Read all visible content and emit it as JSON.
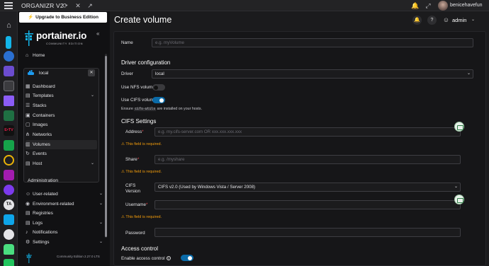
{
  "organizr": {
    "title": "ORGANIZR V2",
    "username": "benicehavefun"
  },
  "colors": {
    "accent": "#0b6ba8",
    "error": "#e5484d",
    "warning": "#f59e0b",
    "upgrade_bg": "#ffffff"
  },
  "sidebar": {
    "upgrade_label": "Upgrade to Business Edition",
    "logo_text": "portainer.io",
    "logo_sub": "COMMUNITY EDITION",
    "home_label": "Home",
    "environment_label": "local",
    "env_items": [
      {
        "label": "Dashboard",
        "icon": "dashboard-icon"
      },
      {
        "label": "Templates",
        "icon": "templates-icon",
        "has_chevron": true
      },
      {
        "label": "Stacks",
        "icon": "stacks-icon"
      },
      {
        "label": "Containers",
        "icon": "containers-icon"
      },
      {
        "label": "Images",
        "icon": "images-icon"
      },
      {
        "label": "Networks",
        "icon": "networks-icon"
      },
      {
        "label": "Volumes",
        "icon": "volumes-icon",
        "active": true
      },
      {
        "label": "Events",
        "icon": "events-icon"
      },
      {
        "label": "Host",
        "icon": "host-icon",
        "has_chevron": true
      }
    ],
    "admin_heading": "Administration",
    "admin_items": [
      {
        "label": "User-related",
        "icon": "users-icon",
        "has_chevron": true
      },
      {
        "label": "Environment-related",
        "icon": "environment-icon",
        "has_chevron": true
      },
      {
        "label": "Registries",
        "icon": "registries-icon"
      },
      {
        "label": "Logs",
        "icon": "logs-icon",
        "has_chevron": true
      },
      {
        "label": "Notifications",
        "icon": "bell-icon"
      },
      {
        "label": "Settings",
        "icon": "settings-icon",
        "has_chevron": true
      }
    ],
    "version": "Community Edition 2.27.0 LTS"
  },
  "header": {
    "title": "Create volume",
    "user": "admin"
  },
  "form": {
    "name_label": "Name",
    "name_placeholder": "e.g. myVolume",
    "driver_section": "Driver configuration",
    "driver_label": "Driver",
    "driver_value": "local",
    "nfs_label": "Use NFS volume",
    "nfs_enabled": false,
    "cifs_label": "Use CIFS volume",
    "cifs_enabled": true,
    "ensure_prefix": "Ensure",
    "ensure_code": "cifs-utils",
    "ensure_suffix": "are installed on your hosts.",
    "cifs_section": "CIFS Settings",
    "address_label": "Address",
    "address_placeholder": "e.g. my.cifs-server.com OR xxx.xxx.xxx.xxx",
    "share_label": "Share",
    "share_placeholder": "e.g. /myshare",
    "required_msg": "This field is required.",
    "cifs_version_label_1": "CIFS",
    "cifs_version_label_2": "Version",
    "cifs_version_value": "CIFS v2.0 (Used by Windows Vista / Server 2008)",
    "username_label": "Username",
    "password_label": "Password",
    "access_section": "Access control",
    "access_label": "Enable access control",
    "access_enabled": true
  }
}
